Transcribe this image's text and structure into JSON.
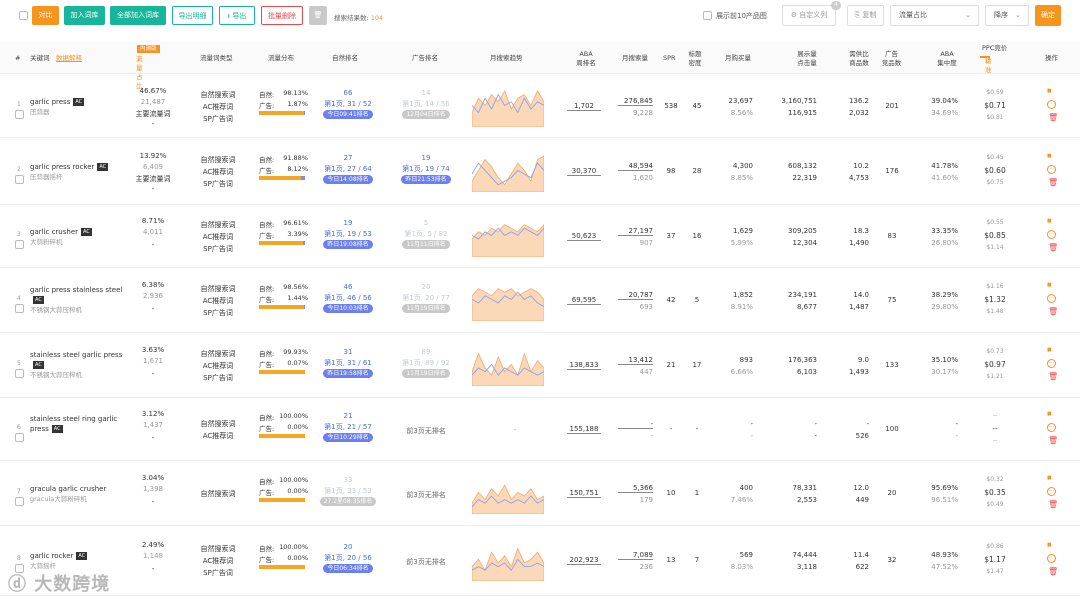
{
  "toolbar": {
    "btn_compare": "对比",
    "btn_add_lib": "加入词库",
    "btn_add_all": "全部加入词库",
    "btn_export_desc": "导出明细",
    "btn_export": "导出",
    "btn_batch_delete": "批量删除",
    "result_label": "搜索结果数:",
    "result_count": "104",
    "show_top10": "展示前10产品图",
    "custom_col": "自定义列",
    "custom_badge": "4",
    "copy": "复制",
    "sort_field": "流量占比",
    "sort_order": "降序",
    "confirm": "确定"
  },
  "header": {
    "num": "#",
    "keyword": "关键词",
    "data_explain": "数据解释",
    "internal_badge": "内测版",
    "traffic_share": "流量占比",
    "traffic_type": "流量词类型",
    "traffic_dist": "流量分布",
    "natural_rank": "自然排名",
    "ad_rank": "广告排名",
    "monthly_trend": "月搜索趋势",
    "aba_rank": "ABA\n周排名",
    "monthly_search": "月搜索量",
    "spr": "SPR",
    "title_density": "标题\n密度",
    "monthly_buy": "月购买量",
    "impressions": "展示量\n点击量",
    "demand_supply": "需供比\n商品数",
    "ad_products": "广告\n竞品数",
    "aba_conc": "ABA\n集中度",
    "ppc": "PPC竞价",
    "ppc_filter": "精准",
    "actions": "操作"
  },
  "rows": [
    {
      "idx": "1",
      "kw": "garlic press",
      "ac": "AC",
      "cn": "压蒜器",
      "share": "46.67%",
      "vol": "21,487",
      "main": "主要流量词",
      "dash": "-",
      "types": [
        "自然搜索词",
        "AC推荐词",
        "SP广告词"
      ],
      "nat_pct": "98.13%",
      "ad_pct": "1.87%",
      "nat_frac": 0.9813,
      "nr": "66",
      "nr_page": "第1页, 31 / 52",
      "nr_time": "今日09:41排名",
      "nr_faded": false,
      "ar": "14",
      "ar_page": "第1页, 14 / 56",
      "ar_time": "12月04日排名",
      "ar_faded": true,
      "aba": "1,702",
      "ms": "276,845",
      "ms2": "9,228",
      "spr": "538",
      "td": "45",
      "mb": "23,697",
      "mb2": "8.56%",
      "imp": "3,160,751",
      "clk": "116,915",
      "ds": "136.2",
      "gs": "2,032",
      "adp": "201",
      "conc": "39.04%",
      "conc2": "34.69%",
      "ppc1": "$0.59",
      "ppc": "$0.71",
      "ppc2": "$0.81",
      "trend_a": [
        4,
        8,
        6,
        9,
        7,
        10,
        5,
        8,
        9,
        6,
        10,
        7
      ],
      "trend_b": [
        6,
        4,
        8,
        5,
        9,
        6,
        7,
        4,
        8,
        5,
        7,
        6
      ]
    },
    {
      "idx": "2",
      "kw": "garlic press rocker",
      "ac": "AC",
      "cn": "压蒜器摇杆",
      "share": "13.92%",
      "vol": "6,409",
      "main": "主要流量词",
      "dash": "-",
      "types": [
        "自然搜索词",
        "AC推荐词",
        "SP广告词"
      ],
      "nat_pct": "91.88%",
      "ad_pct": "8.12%",
      "nat_frac": 0.9188,
      "nr": "27",
      "nr_page": "第1页, 27 / 64",
      "nr_time": "今日14:08排名",
      "nr_faded": false,
      "ar": "19",
      "ar_page": "第1页, 19 / 74",
      "ar_time": "昨日21:53排名",
      "ar_faded": false,
      "aba": "30,370",
      "ms": "48,594",
      "ms2": "1,620",
      "spr": "98",
      "td": "28",
      "mb": "4,300",
      "mb2": "8.85%",
      "imp": "608,132",
      "clk": "22,319",
      "ds": "10.2",
      "gs": "4,753",
      "adp": "176",
      "conc": "41.78%",
      "conc2": "41.60%",
      "ppc1": "$0.45",
      "ppc": "$0.60",
      "ppc2": "$0.75",
      "trend_a": [
        3,
        6,
        9,
        7,
        4,
        2,
        5,
        8,
        6,
        3,
        9,
        10
      ],
      "trend_b": [
        5,
        8,
        6,
        4,
        2,
        3,
        4,
        6,
        5,
        4,
        8,
        6
      ]
    },
    {
      "idx": "3",
      "kw": "garlic crusher",
      "ac": "AC",
      "cn": "大蒜粉碎机",
      "share": "8.71%",
      "vol": "4,011",
      "main": "",
      "dash": "-",
      "types": [
        "自然搜索词",
        "AC推荐词",
        "SP广告词"
      ],
      "nat_pct": "96.61%",
      "ad_pct": "3.39%",
      "nat_frac": 0.9661,
      "nr": "19",
      "nr_page": "第1页, 19 / 53",
      "nr_time": "昨日19:08排名",
      "nr_faded": false,
      "ar": "5",
      "ar_page": "第1页, 5 / 82",
      "ar_time": "11月11日排名",
      "ar_faded": true,
      "aba": "50,623",
      "ms": "27,197",
      "ms2": "907",
      "spr": "37",
      "td": "16",
      "mb": "1,629",
      "mb2": "5.99%",
      "imp": "309,205",
      "clk": "12,304",
      "ds": "18.3",
      "gs": "1,490",
      "adp": "83",
      "conc": "33.35%",
      "conc2": "26.80%",
      "ppc1": "$0.55",
      "ppc": "$0.85",
      "ppc2": "$1.14",
      "trend_a": [
        5,
        7,
        6,
        8,
        7,
        9,
        8,
        7,
        9,
        8,
        7,
        9
      ],
      "trend_b": [
        6,
        5,
        7,
        6,
        8,
        6,
        7,
        6,
        8,
        7,
        6,
        8
      ]
    },
    {
      "idx": "4",
      "kw": "garlic press stainless steel",
      "ac": "AC",
      "cn": "不锈钢大蒜压榨机",
      "share": "6.38%",
      "vol": "2,936",
      "main": "",
      "dash": "-",
      "types": [
        "自然搜索词",
        "AC推荐词",
        "SP广告词"
      ],
      "nat_pct": "98.56%",
      "ad_pct": "1.44%",
      "nat_frac": 0.9856,
      "nr": "46",
      "nr_page": "第1页, 46 / 56",
      "nr_time": "今日10:03排名",
      "nr_faded": false,
      "ar": "20",
      "ar_page": "第1页, 20 / 77",
      "ar_time": "11月19日排名",
      "ar_faded": true,
      "aba": "69,595",
      "ms": "20,787",
      "ms2": "693",
      "spr": "42",
      "td": "5",
      "mb": "1,852",
      "mb2": "8.91%",
      "imp": "234,191",
      "clk": "8,677",
      "ds": "14.0",
      "gs": "1,487",
      "adp": "75",
      "conc": "38.29%",
      "conc2": "29.80%",
      "ppc1": "$1.16",
      "ppc": "$1.32",
      "ppc2": "$1.48",
      "trend_a": [
        7,
        9,
        8,
        7,
        9,
        8,
        9,
        7,
        8,
        9,
        8,
        6
      ],
      "trend_b": [
        6,
        5,
        7,
        6,
        5,
        7,
        6,
        8,
        6,
        7,
        5,
        4
      ]
    },
    {
      "idx": "5",
      "kw": "stainless steel garlic press",
      "ac": "AC",
      "cn": "不锈钢大蒜压榨机",
      "share": "3.63%",
      "vol": "1,671",
      "main": "",
      "dash": "-",
      "types": [
        "自然搜索词",
        "AC推荐词",
        "SP广告词"
      ],
      "nat_pct": "99.93%",
      "ad_pct": "0.07%",
      "nat_frac": 0.9993,
      "nr": "31",
      "nr_page": "第1页, 31 / 61",
      "nr_time": "昨日19:58排名",
      "nr_faded": false,
      "ar": "89",
      "ar_page": "第1页, 89 / 92",
      "ar_time": "11月19日排名",
      "ar_faded": true,
      "aba": "138,833",
      "ms": "13,412",
      "ms2": "447",
      "spr": "21",
      "td": "17",
      "mb": "893",
      "mb2": "6.66%",
      "imp": "176,363",
      "clk": "6,103",
      "ds": "9.0",
      "gs": "1,493",
      "adp": "133",
      "conc": "35.10%",
      "conc2": "30.17%",
      "ppc1": "$0.73",
      "ppc": "$0.97",
      "ppc2": "$1.21",
      "trend_a": [
        4,
        9,
        5,
        3,
        8,
        4,
        6,
        3,
        9,
        4,
        7,
        5
      ],
      "trend_b": [
        3,
        5,
        4,
        6,
        3,
        5,
        4,
        3,
        5,
        4,
        3,
        4
      ]
    },
    {
      "idx": "6",
      "kw": "stainless steel ring garlic press",
      "ac": "AC",
      "cn": "",
      "share": "3.12%",
      "vol": "1,437",
      "main": "",
      "dash": "-",
      "types": [
        "自然搜索词",
        "AC推荐词"
      ],
      "nat_pct": "100.00%",
      "ad_pct": "0.00%",
      "nat_frac": 1.0,
      "nr": "21",
      "nr_page": "第1页, 21 / 57",
      "nr_time": "今日10:29排名",
      "nr_faded": false,
      "ar": "",
      "ar_page": "前3页无排名",
      "ar_time": "",
      "ar_faded": false,
      "aba": "155,188",
      "ms": "-",
      "ms2": "-",
      "spr": "-",
      "td": "-",
      "mb": "-",
      "mb2": "-",
      "imp": "-",
      "clk": "-",
      "ds": "-",
      "gs": "526",
      "adp": "100",
      "conc": "-",
      "conc2": "-",
      "ppc1": "--",
      "ppc": "--",
      "ppc2": "--",
      "trend_dash": "-"
    },
    {
      "idx": "7",
      "kw": "gracula garlic crusher",
      "ac": "",
      "cn": "gracula大蒜粉碎机",
      "share": "3.04%",
      "vol": "1,398",
      "main": "",
      "dash": "-",
      "types": [
        "自然搜索词"
      ],
      "nat_pct": "100.00%",
      "ad_pct": "0.00%",
      "nat_frac": 1.0,
      "nr": "33",
      "nr_page": "第1页, 33 / 53",
      "nr_time": "27.2星08:35排名",
      "nr_faded": true,
      "ar": "",
      "ar_page": "前3页无排名",
      "ar_time": "",
      "ar_faded": false,
      "aba": "150,751",
      "ms": "5,366",
      "ms2": "179",
      "spr": "10",
      "td": "1",
      "mb": "400",
      "mb2": "7.46%",
      "imp": "78,331",
      "clk": "2,553",
      "ds": "12.0",
      "gs": "449",
      "adp": "20",
      "conc": "95.69%",
      "conc2": "96.51%",
      "ppc1": "$0.32",
      "ppc": "$0.35",
      "ppc2": "$0.49",
      "trend_a": [
        3,
        6,
        4,
        7,
        5,
        8,
        4,
        6,
        5,
        7,
        4,
        5
      ],
      "trend_b": [
        2,
        4,
        3,
        5,
        3,
        4,
        3,
        4,
        3,
        5,
        3,
        4
      ]
    },
    {
      "idx": "8",
      "kw": "garlic rocker",
      "ac": "AC",
      "cn": "大蒜摇杆",
      "share": "2.49%",
      "vol": "1,148",
      "main": "",
      "dash": "-",
      "types": [
        "自然搜索词",
        "AC推荐词",
        "SP广告词"
      ],
      "nat_pct": "100.00%",
      "ad_pct": "0.00%",
      "nat_frac": 1.0,
      "nr": "20",
      "nr_page": "第1页, 20 / 56",
      "nr_time": "今日06:34排名",
      "nr_faded": false,
      "ar": "",
      "ar_page": "前3页无排名",
      "ar_time": "",
      "ar_faded": false,
      "aba": "202,923",
      "ms": "7,089",
      "ms2": "236",
      "spr": "13",
      "td": "7",
      "mb": "569",
      "mb2": "8.03%",
      "imp": "74,444",
      "clk": "3,118",
      "ds": "11.4",
      "gs": "622",
      "adp": "32",
      "conc": "48.93%",
      "conc2": "47.52%",
      "ppc1": "$0.86",
      "ppc": "$1.17",
      "ppc2": "$1.47",
      "trend_a": [
        4,
        6,
        3,
        8,
        5,
        7,
        4,
        9,
        5,
        6,
        8,
        5
      ],
      "trend_b": [
        3,
        4,
        3,
        5,
        4,
        5,
        3,
        6,
        4,
        4,
        5,
        4
      ]
    }
  ],
  "labels": {
    "nat": "自然:",
    "ad": "广告:"
  },
  "watermark": "大数跨境",
  "colors": {
    "orange": "#f7941d",
    "teal": "#17b59a",
    "blue": "#4a6ee0",
    "pill": "#6c7ff0",
    "bar": "#f5a623"
  }
}
